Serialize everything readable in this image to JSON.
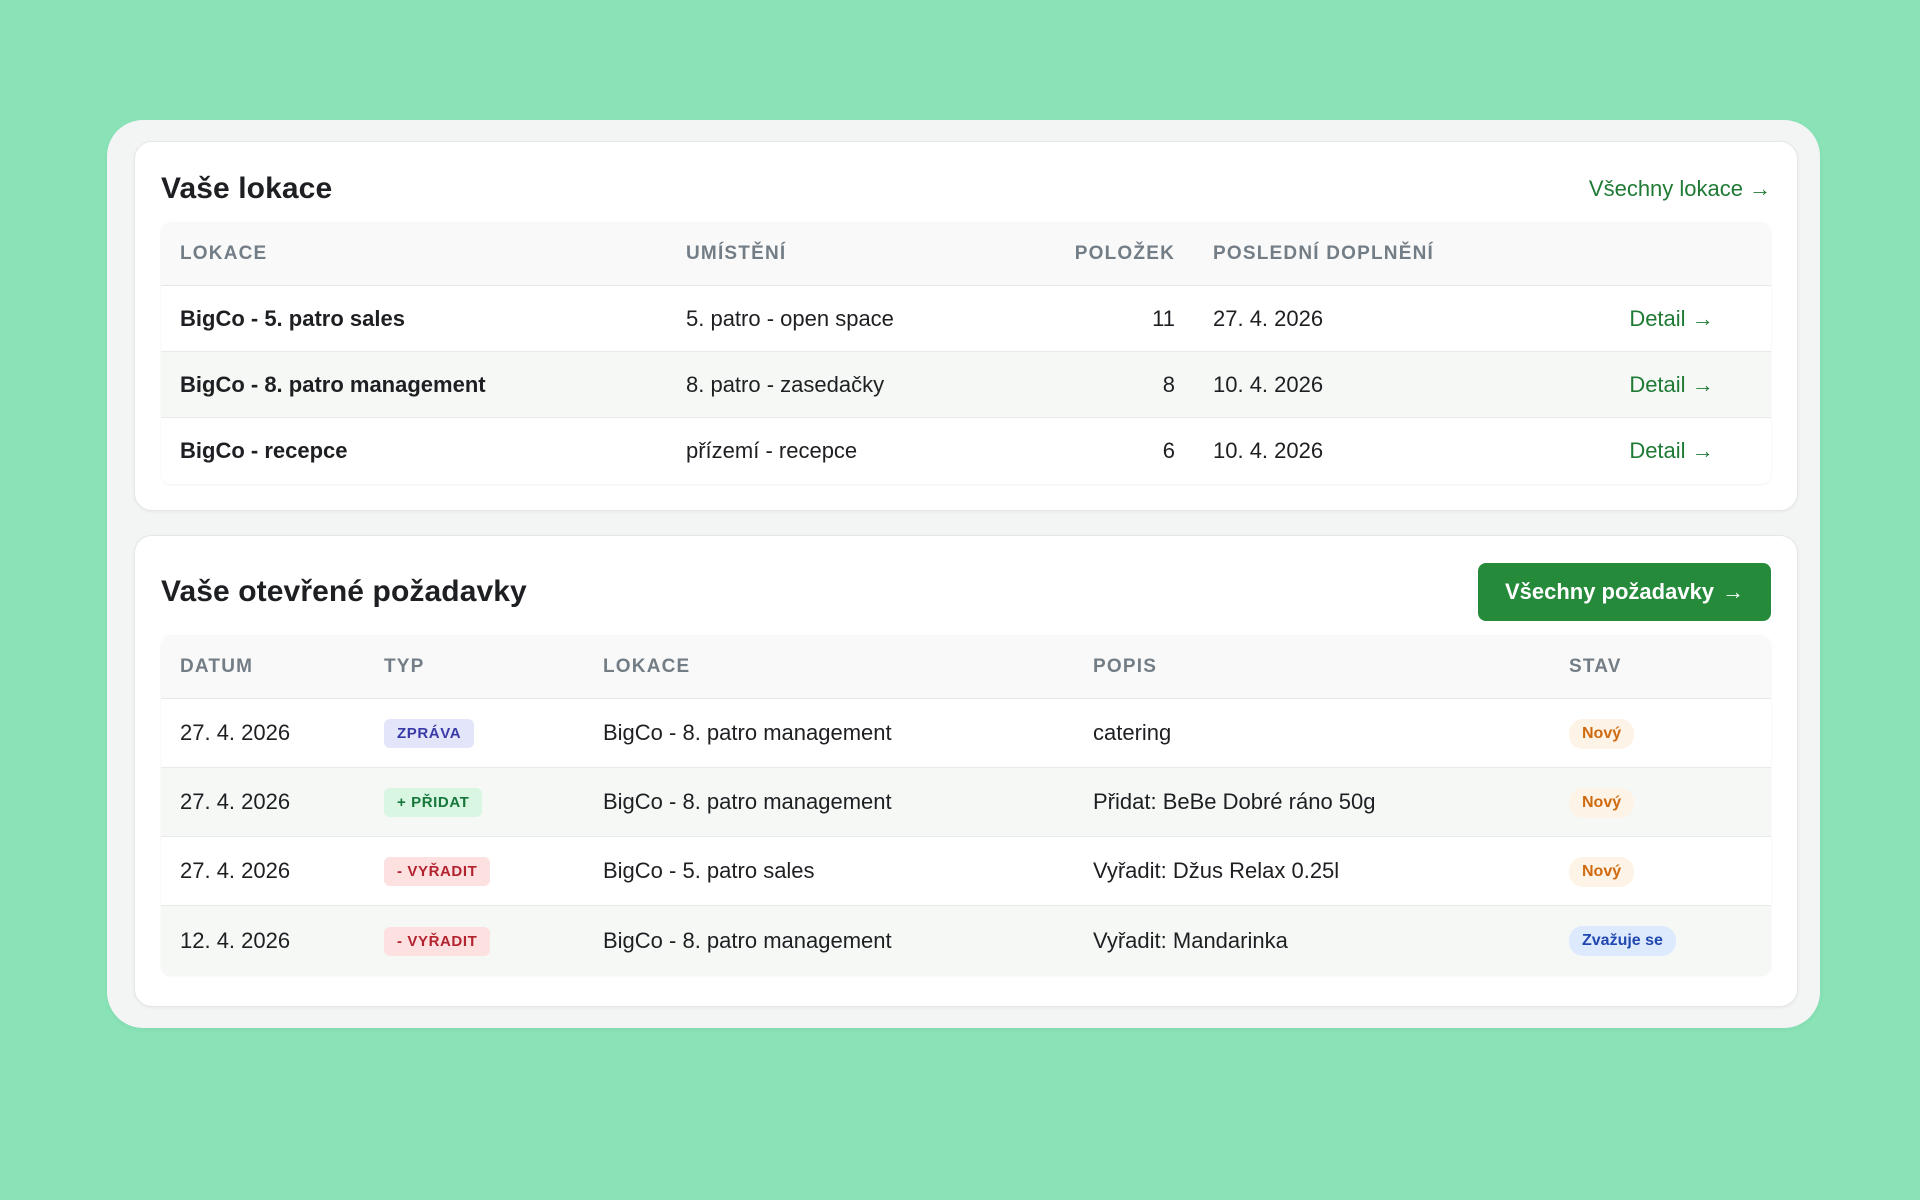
{
  "locations": {
    "title": "Vaše lokace",
    "all_link": "Všechny lokace",
    "columns": [
      "Lokace",
      "Umístění",
      "Položek",
      "Poslední doplnění",
      ""
    ],
    "rows": [
      {
        "name": "BigCo - 5. patro sales",
        "place": "5. patro - open space",
        "items": "11",
        "last_refill": "27. 4. 2026",
        "action": "Detail"
      },
      {
        "name": "BigCo - 8. patro management",
        "place": "8. patro - zasedačky",
        "items": "8",
        "last_refill": "10. 4. 2026",
        "action": "Detail"
      },
      {
        "name": "BigCo - recepce",
        "place": "přízemí - recepce",
        "items": "6",
        "last_refill": "10. 4. 2026",
        "action": "Detail"
      }
    ]
  },
  "requests": {
    "title": "Vaše otevřené požadavky",
    "all_button": "Všechny požadavky",
    "columns": [
      "Datum",
      "Typ",
      "Lokace",
      "Popis",
      "Stav"
    ],
    "rows": [
      {
        "date": "27. 4. 2026",
        "type": "ZPRÁVA",
        "type_style": "message",
        "location": "BigCo - 8. patro management",
        "description": "catering",
        "status": "Nový",
        "status_style": "new"
      },
      {
        "date": "27. 4. 2026",
        "type": "+ PŘIDAT",
        "type_style": "add",
        "location": "BigCo - 8. patro management",
        "description": "Přidat: BeBe Dobré ráno 50g",
        "status": "Nový",
        "status_style": "new"
      },
      {
        "date": "27. 4. 2026",
        "type": "- VYŘADIT",
        "type_style": "remove",
        "location": "BigCo - 5. patro sales",
        "description": "Vyřadit: Džus Relax 0.25l",
        "status": "Nový",
        "status_style": "new"
      },
      {
        "date": "12. 4. 2026",
        "type": "- VYŘADIT",
        "type_style": "remove",
        "location": "BigCo - 8. patro management",
        "description": "Vyřadit: Mandarinka",
        "status": "Zvažuje se",
        "status_style": "considering"
      }
    ]
  },
  "icons": {
    "arrow": "arrow-right-icon"
  },
  "colors": {
    "background": "#89e3b7",
    "accent": "#268a3b",
    "link": "#1f7a35",
    "badge_message": {
      "bg": "#e3e5fb",
      "fg": "#3a3aa6"
    },
    "badge_add": {
      "bg": "#d8f6e2",
      "fg": "#17763a"
    },
    "badge_remove": {
      "bg": "#fde0e0",
      "fg": "#b3232f"
    },
    "status_new": {
      "bg": "#fdf3e6",
      "fg": "#cf6a10"
    },
    "status_considering": {
      "bg": "#dde9fd",
      "fg": "#2147b0"
    }
  }
}
